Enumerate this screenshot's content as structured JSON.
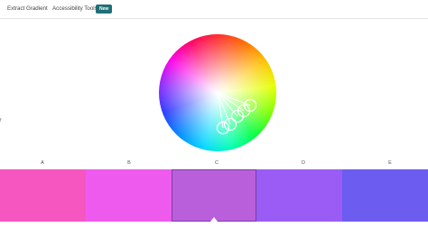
{
  "nav": {
    "links": [
      {
        "label": "Extract Gradient"
      },
      {
        "label": "Accessibility Tools"
      }
    ],
    "badge": "New"
  },
  "side_mark": "f",
  "palette": {
    "active_index": 2,
    "swatches": [
      {
        "label": "A",
        "color": "#f556bf"
      },
      {
        "label": "B",
        "color": "#ef5aee"
      },
      {
        "label": "C",
        "color": "#b95fdc"
      },
      {
        "label": "D",
        "color": "#9a5cf5"
      },
      {
        "label": "E",
        "color": "#6c5cf0"
      }
    ]
  },
  "wheel": {
    "handle_icon": "color-picker-handle-icon"
  }
}
